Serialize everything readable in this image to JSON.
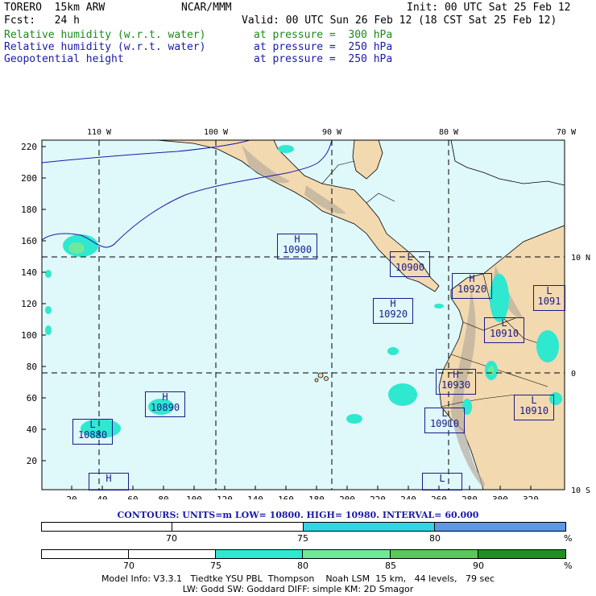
{
  "header": {
    "model": "TORERO  15km ARW",
    "center": "NCAR/MMM",
    "init": "Init: 00 UTC Sat 25 Feb 12",
    "fcst": "Fcst:   24 h",
    "valid": "Valid: 00 UTC Sun 26 Feb 12 (18 CST Sat 25 Feb 12)",
    "fields": [
      {
        "name": "Relative humidity (w.r.t. water)",
        "level": "at pressure =  300 hPa",
        "color": "#1a8a1a"
      },
      {
        "name": "Relative humidity (w.r.t. water)",
        "level": "at pressure =  250 hPa",
        "color": "#1a1aa8"
      },
      {
        "name": "Geopotential height",
        "level": "at pressure =  250 hPa",
        "color": "#1a1aa8"
      }
    ]
  },
  "map": {
    "top_lon_labels": [
      "110 W",
      "100 W",
      "90 W",
      "80 W",
      "70 W"
    ],
    "right_lat_labels": [
      "10 N",
      "0",
      "10 S"
    ],
    "y_ticks": [
      "220",
      "200",
      "180",
      "160",
      "140",
      "120",
      "100",
      "80",
      "60",
      "40",
      "20"
    ],
    "x_ticks": [
      "20",
      "40",
      "60",
      "80",
      "100",
      "120",
      "140",
      "160",
      "180",
      "200",
      "220",
      "240",
      "260",
      "280",
      "300",
      "320"
    ],
    "colors": {
      "ocean": "#dff8fa",
      "land": "#f2d9b0",
      "contour": "#1a1aa8"
    },
    "centers": [
      {
        "letter": "H",
        "value": "10900"
      },
      {
        "letter": "L",
        "value": "10900"
      },
      {
        "letter": "H",
        "value": "10920"
      },
      {
        "letter": "H",
        "value": "10920"
      },
      {
        "letter": "L",
        "value": "10910"
      },
      {
        "letter": "L",
        "value": "1091"
      },
      {
        "letter": "H",
        "value": "10930"
      },
      {
        "letter": "H",
        "value": "10890"
      },
      {
        "letter": "L",
        "value": "10910"
      },
      {
        "letter": "L",
        "value": "10910"
      },
      {
        "letter": "L",
        "value": "10880"
      },
      {
        "letter": "H",
        "value": ""
      },
      {
        "letter": "L",
        "value": ""
      }
    ]
  },
  "contours_info": "CONTOURS:  UNITS=m  LOW=  10800.      HIGH=  10980.      INTERVAL=   60.000",
  "legend1": {
    "labels": [
      "70",
      "75",
      "80",
      "%"
    ],
    "colors": [
      "#ffffff",
      "#ffffff",
      "#33d3e8",
      "#5b98e8"
    ]
  },
  "legend2": {
    "labels": [
      "70",
      "75",
      "80",
      "85",
      "90",
      "%"
    ],
    "colors": [
      "#ffffff",
      "#ffffff",
      "#ffffff",
      "#2ee8d0",
      "#6ee89a",
      "#58c858",
      "#1f8f1f"
    ]
  },
  "footer": {
    "line1": "Model Info: V3.3.1   Tiedtke YSU PBL  Thompson    Noah LSM  15 km,   44 levels,   79 sec",
    "line2": "LW: Godd SW: Goddard DIFF: simple KM: 2D Smagor"
  }
}
